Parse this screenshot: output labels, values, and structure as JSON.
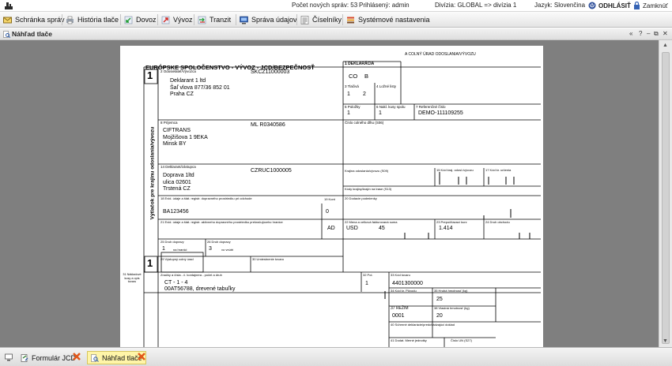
{
  "topbar": {
    "pending_messages": "Počet nových správ: 53",
    "logged_in": "Prihlásený: admin",
    "division": "Divízia: GLOBAL => divízia 1",
    "language": "Jazyk: Slovenčina",
    "logout": "ODHLÁSIŤ",
    "lock": "Zamknúť"
  },
  "menu": {
    "items": [
      {
        "label": "Schránka správ",
        "icon": "inbox-icon"
      },
      {
        "label": "História tlače",
        "icon": "print-history-icon"
      },
      {
        "label": "Dovoz",
        "icon": "import-icon"
      },
      {
        "label": "Vývoz",
        "icon": "export-icon"
      },
      {
        "label": "Tranzit",
        "icon": "transit-icon"
      },
      {
        "label": "Správa údajov",
        "icon": "data-management-icon"
      },
      {
        "label": "Číselníky",
        "icon": "codelist-icon"
      },
      {
        "label": "Systémové nastavenia",
        "icon": "settings-icon"
      }
    ]
  },
  "panel": {
    "title": "Náhľad tlače",
    "controls": [
      "«",
      "?",
      "–",
      "⧉",
      "✕"
    ]
  },
  "document": {
    "header": "EURÓPSKE SPOLOČENSTVO - VÝVOZ - JCD/BEZPEČNOSŤ",
    "side_text": "Výtlačok pre krajinu odoslania/vývozu",
    "copy_no": "1",
    "customs_office_label": "A COLNÝ ÚRAD ODOSLANIA/VÝVOZU",
    "box1_label": "1 DEKLARÁCIA",
    "box1_value1": "CO",
    "box1_value2": "B",
    "box2_label": "2 Odosielateľ/Vývozca",
    "box2_no": "SKCZ11000003",
    "box2_lines": [
      "Deklarant 1 ltd",
      "Šaľ vlova 877/36 852 01",
      "Praha CZ"
    ],
    "box3_label": "3 Tlačivá",
    "box3_value1": "1",
    "box3_value2": "2",
    "box4_label": "4 Ložné listy",
    "box5_label": "5 Položky",
    "box5_value": "1",
    "box6_label": "6 Nakl. kusy spolu",
    "box6_value": "1",
    "box7_label": "7 Referenčné číslo",
    "box7_value": "DEMO-111109255",
    "box8_label": "8 Príjemca",
    "box8_no": "ML R0340586",
    "box8_lines": [
      "CIFTRANS",
      "Mojžišova 1 9EKA",
      "Minsk BY"
    ],
    "box9_label": "Číslo colného dlhu (S06)",
    "box14_label": "14 Deklarant/zástupca",
    "box14_no": "CZRUC1000005",
    "box14_lines": [
      "Doprava 1ltd",
      "ulica 02601",
      "Trstená CZ"
    ],
    "box15_label": "Krajina odoslania/vývozu (S09)",
    "box15a_label": "15 Kód kraj. odosl./vývozu",
    "box17_label": "17 Kód kr. určenia",
    "box16_label": "Kódy krajiny/krajín na trase (S13)",
    "box18_label": "18 Evid. údaje a štát. registr. dopravného prostriedku pri odchode",
    "box18_value": "BA123456",
    "box19_label": "19 Kont",
    "box19_value": "0",
    "box20_label": "20 Dodacie podmienky",
    "box21_label": "21 Evid. údaje a štát. registr. aktívneho dopravného prostriedku prekračujúceho hranice",
    "box21_value": "AD",
    "box22_label": "22 Mena a celková fakturovaná suma",
    "box22_value1": "USD",
    "box22_value2": "45",
    "box23_label": "23 Prepočítavací kurz",
    "box23_value": "1.414",
    "box24_label": "24 Druh obchodu",
    "box25_label": "25 Druh dopravy",
    "box25_value": "1",
    "box25_sub": "na hranici",
    "box26_label": "26 Druh dopravy",
    "box26_value": "3",
    "box26_sub": "vo vnútri",
    "box29_label": "29 Výstupný colný úrad",
    "box30_label": "30 Umiestnenie tovaru",
    "box31_label": "31 Nákladové kusy a opis tovaru",
    "box31_sub": "Značky a čísla - č. kontajnera - počet a druh",
    "box31_lines": [
      "CT - 1 - 4",
      "00AT56788, drevené tabuľky"
    ],
    "box32_label": "32 Pol.",
    "box32_value": "1",
    "box33_label": "33 Kód tovaru",
    "box33_value": "4401300000",
    "box34_label": "34 Kód kr. Pôvodu",
    "box35_label": "35 Hrubá hmotnosť (kg)",
    "box35_value": "25",
    "box37_label": "37 REŽIM",
    "box37_value": "0001",
    "box38_label": "38 Vlastná hmotnosť (kg)",
    "box38_value": "20",
    "box40_label": "40 Súhrnné deklarácie/predchádzajúci doklad",
    "box41_label": "41 Dodat. Merné jednotky",
    "box44_label": "Číslo UN (S27)"
  },
  "pdf_toolbar": [
    "fit-page-icon",
    "fit-width-icon",
    "zoom-out-icon",
    "zoom-in-icon",
    "save-icon",
    "print-icon"
  ],
  "taskbar": {
    "items": [
      {
        "label": "Formulár JCD",
        "active": false
      },
      {
        "label": "Náhľad tlače",
        "active": true
      }
    ]
  }
}
